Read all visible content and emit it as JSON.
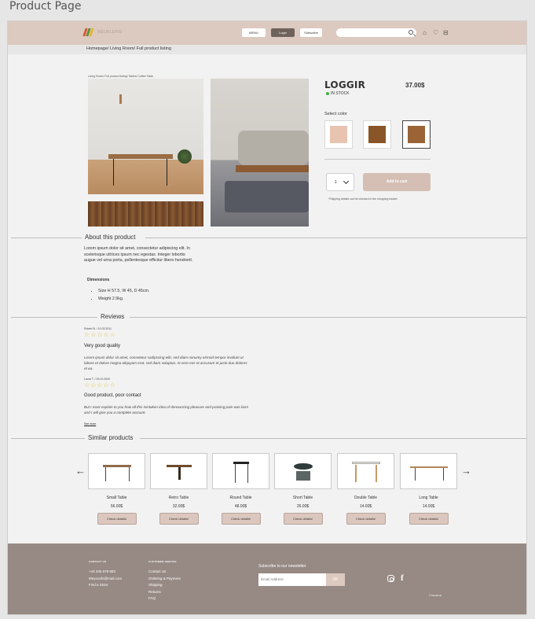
{
  "window": {
    "title": "Product Page"
  },
  "header": {
    "logo_text": "MEUBLERIE",
    "nav": {
      "btn1": "MENU",
      "btn2": "Login",
      "btn3": "Subscribe"
    },
    "search_placeholder": ""
  },
  "breadcrumb": "Homepage/ Living Room/ Full product listing",
  "gallery": {
    "caption": "Living Room/ Full product listing/ Tables/ Coffee Table"
  },
  "product": {
    "brand": "LOGGIR",
    "price": "37.00$",
    "stock": "IN STOCK",
    "select_color_label": "Select color",
    "colors": [
      "#e8c4b0",
      "#8a5527",
      "#9a6436"
    ],
    "quantity": "1",
    "add_to_cart": "Add to cart",
    "shipping_note": "*Shipping details can be checked in the shopping basket"
  },
  "about": {
    "title": "About this product",
    "text": "Lorem ipsum dolor sit amet, consectetur adipiscing elit. In scelerisque ultrices ipsum nec egestas. Integer lobortis augue vel urna porta, pellentesque efficitur libero hendrerit.",
    "dimensions_title": "Dimensions",
    "dimensions": [
      "Size H 57.5, W 45, D 45cm.",
      "Weight 2.9kg."
    ]
  },
  "reviews": {
    "title": "Reviews",
    "items": [
      {
        "author": "Robert B. / 10.03.2011",
        "stars": "☆☆☆☆☆",
        "title": "Very good quality",
        "body": "Lorem ipsum dolor sit amet, consetetur sadipscing elitr, sed diam nonumy eirmod tempor invidunt ut labore et dolore magna aliquyam erat, sed diam voluptua. At vero eos et accusam et justo duo dolores et ea."
      },
      {
        "author": "Laura T. / 05.10.2020",
        "stars": "☆☆☆☆☆",
        "title": "Good product, poor contact",
        "body": "But I must explain to you how all this mistaken idea of denouncing pleasure and praising pain was born and I will give you a complete account."
      }
    ],
    "see_more": "See more"
  },
  "similar": {
    "title": "Similar products",
    "check_label": "Check details!",
    "items": [
      {
        "name": "Small Table",
        "price": "56.00$"
      },
      {
        "name": "Retro Table",
        "price": "32.00$"
      },
      {
        "name": "Round Table",
        "price": "48.00$"
      },
      {
        "name": "Short Table",
        "price": "26.00$"
      },
      {
        "name": "Double Table",
        "price": "14.00$"
      },
      {
        "name": "Long Table",
        "price": "14.00$"
      }
    ]
  },
  "footer": {
    "col1_head": "CONTACT US",
    "col1": [
      "+44 345 678 903",
      "Meynoofs@mail.com",
      "Find a Store"
    ],
    "col2_head": "CUSTOMER SERVICE",
    "col2": [
      "Contact Us",
      "Ordering & Payment",
      "Shipping",
      "Returns",
      "FAQ"
    ],
    "subscribe": "Subscribe to our newsletter",
    "email_placeholder": "Email Address",
    "ok": "OK",
    "copyright": "© Meubleria"
  }
}
